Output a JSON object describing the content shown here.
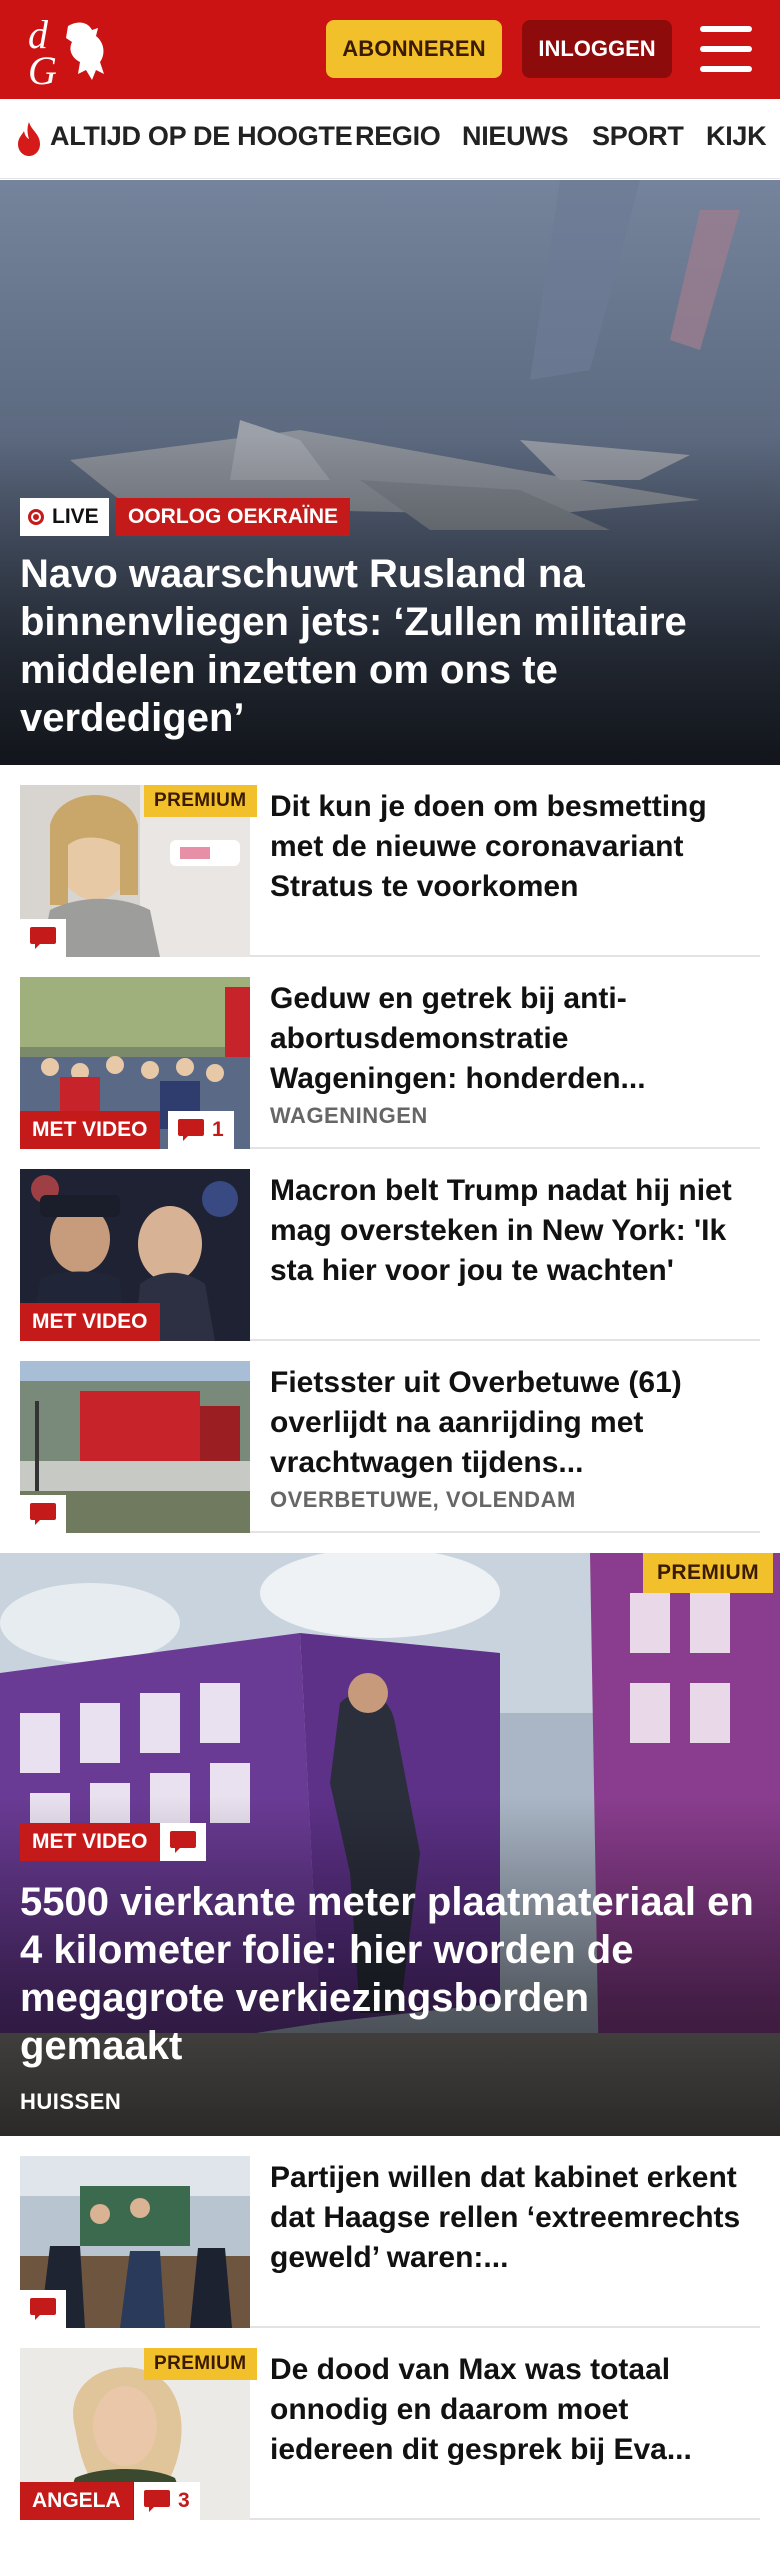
{
  "header": {
    "logo_text": "dG",
    "subscribe_label": "ABONNEREN",
    "login_label": "INLOGGEN",
    "menu_icon": "hamburger-icon",
    "brand_color": "#cc1313"
  },
  "nav": {
    "items": [
      {
        "label": "ALTIJD OP DE HOOGTE",
        "icon": "flame-icon"
      },
      {
        "label": "REGIO"
      },
      {
        "label": "NIEUWS"
      },
      {
        "label": "SPORT"
      },
      {
        "label": "KIJK"
      }
    ]
  },
  "hero": {
    "live_label": "LIVE",
    "category": "OORLOG OEKRAÏNE",
    "title": "Navo waarschuwt Rusland na binnenvliegen jets: ‘Zullen militaire middelen inzetten om ons te verdedigen’"
  },
  "articles": [
    {
      "title": "Dit kun je doen om besmetting met de nieuwe coronavariant Stratus te voorkomen",
      "premium": "PREMIUM",
      "location": "",
      "comments": ""
    },
    {
      "title": "Geduw en getrek bij anti-abortusdemonstratie Wageningen: honderden...",
      "video": "MET VIDEO",
      "comments": "1",
      "location": "WAGENINGEN"
    },
    {
      "title": "Macron belt Trump nadat hij niet mag oversteken in New York: 'Ik sta hier voor jou te wachten'",
      "video": "MET VIDEO",
      "location": ""
    },
    {
      "title": "Fietsster uit Overbetuwe (61) overlijdt na aanrijding met vrachtwagen tijdens...",
      "location": "OVERBETUWE, VOLENDAM",
      "comments": ""
    }
  ],
  "feature": {
    "premium": "PREMIUM",
    "video": "MET VIDEO",
    "title": "5500 vierkante meter plaatmateriaal en 4 kilometer folie: hier worden de megagrote verkiezingsborden gemaakt",
    "location": "HUISSEN"
  },
  "articles2": [
    {
      "title": "Partijen willen dat kabinet erkent dat Haagse rellen ‘extreemrechts geweld’ waren:...",
      "comments": ""
    },
    {
      "title": "De dood van Max was totaal onnodig en daarom moet iedereen dit gesprek bij Eva...",
      "premium": "PREMIUM",
      "tag": "ANGELA",
      "comments": "3"
    }
  ],
  "colors": {
    "accent_red": "#c41a1a",
    "premium_yellow": "#f2c02b"
  }
}
